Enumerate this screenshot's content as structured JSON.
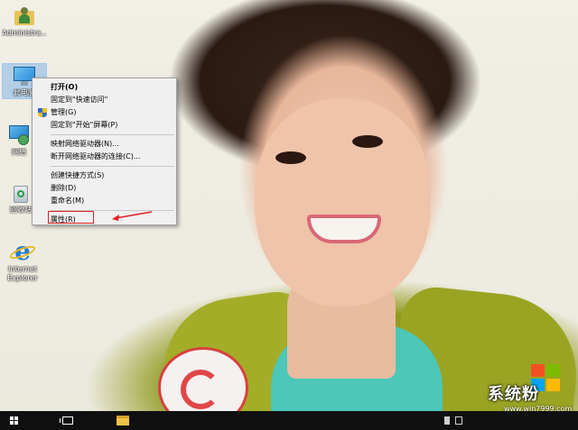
{
  "desktop": {
    "icons": [
      {
        "label": "Administra...",
        "icon": "user-folder-icon"
      },
      {
        "label": "此电脑",
        "icon": "this-pc-icon"
      },
      {
        "label": "网络",
        "icon": "network-icon"
      },
      {
        "label": "回收站",
        "icon": "recycle-bin-icon"
      },
      {
        "label": "Internet Explorer",
        "icon": "internet-explorer-icon"
      }
    ]
  },
  "context_menu": {
    "items": [
      {
        "label": "打开(O)"
      },
      {
        "label": "固定到\"快速访问\""
      },
      {
        "label": "管理(G)",
        "icon": "uac-shield-icon"
      },
      {
        "label": "固定到\"开始\"屏幕(P)"
      },
      {
        "label": "映射网络驱动器(N)..."
      },
      {
        "label": "断开网络驱动器的连接(C)..."
      },
      {
        "label": "创建快捷方式(S)"
      },
      {
        "label": "删除(D)"
      },
      {
        "label": "重命名(M)"
      },
      {
        "label": "属性(R)"
      }
    ],
    "annotation_color": "#e02020"
  },
  "taskbar": {
    "buttons": [
      "start-icon",
      "task-view-icon",
      "file-explorer-icon"
    ]
  },
  "watermark": {
    "title": "系统粉",
    "url": "www.win7999.com",
    "logo_colors": [
      "#f25022",
      "#7fba00",
      "#00a4ef",
      "#ffb900"
    ]
  }
}
